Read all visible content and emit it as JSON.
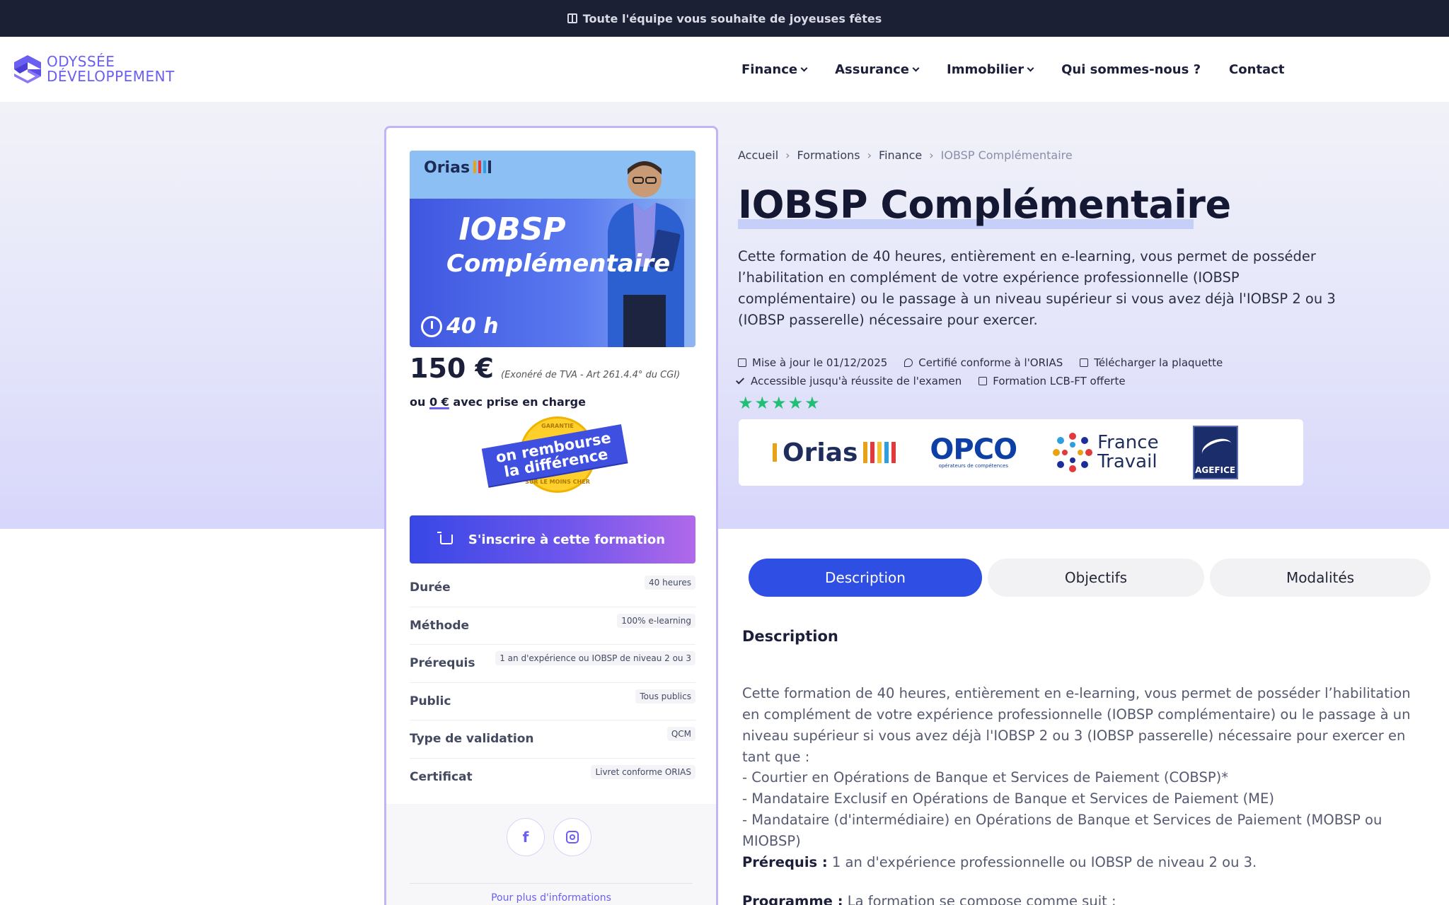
{
  "topbar": {
    "message": "Toute l'équipe vous souhaite de joyeuses fêtes"
  },
  "brand": {
    "line1": "ODYSSÉE",
    "line2": "DÉVELOPPEMENT",
    "accent": "#6a5ff0"
  },
  "nav": {
    "items": [
      {
        "label": "Finance",
        "dropdown": true
      },
      {
        "label": "Assurance",
        "dropdown": true
      },
      {
        "label": "Immobilier",
        "dropdown": true
      },
      {
        "label": "Qui sommes-nous ?",
        "dropdown": false
      },
      {
        "label": "Contact",
        "dropdown": false
      }
    ]
  },
  "product_image": {
    "orias": "Orias",
    "title_line1": "IOBSP",
    "title_line2": "Complémentaire",
    "duration": "40 h"
  },
  "pricing": {
    "price": "150 €",
    "tax_note": "(Exonéré de TVA - Art 261.4.4° du CGI)",
    "alt_prefix": "ou",
    "alt_amount": "0 €",
    "alt_suffix": "avec prise en charge"
  },
  "guarantee_badge": {
    "top_text": "GARANTIE",
    "band_line1": "on rembourse",
    "band_line2": "la différence",
    "bottom_text": "SUR LE MOINS CHER"
  },
  "cta": {
    "label": "S'inscrire à cette formation"
  },
  "specs": [
    {
      "label": "Durée",
      "value": "40 heures"
    },
    {
      "label": "Méthode",
      "value": "100% e-learning"
    },
    {
      "label": "Prérequis",
      "value": "1 an d'expérience ou IOBSP de niveau 2 ou 3"
    },
    {
      "label": "Public",
      "value": "Tous publics"
    },
    {
      "label": "Type de validation",
      "value": "QCM"
    },
    {
      "label": "Certificat",
      "value": "Livret conforme ORIAS"
    }
  ],
  "card_footer": {
    "facebook": "f",
    "more_info": "Pour plus d'informations"
  },
  "breadcrumb": [
    "Accueil",
    "Formations",
    "Finance",
    "IOBSP Complémentaire"
  ],
  "page": {
    "title": "IOBSP Complémentaire",
    "intro": "Cette formation de 40 heures, entièrement en e-learning, vous permet de posséder l’habilitation en complément de votre expérience professionnelle (IOBSP complémentaire) ou le passage à un niveau supérieur si vous avez déjà l'IOBSP 2 ou 3 (IOBSP passerelle) nécessaire pour exercer."
  },
  "meta": {
    "updated": "Mise à jour le 01/12/2025",
    "certified": "Certifié conforme à l'ORIAS",
    "download": "Télécharger la plaquette",
    "access": "Accessible jusqu'à réussite de l'examen",
    "gift": "Formation LCB-FT offerte",
    "stars": "★★★★★",
    "rating": 5
  },
  "partners": {
    "orias": "Orias",
    "opco": "OPCO",
    "opco_sub": "opérateurs de compétences",
    "ft_line1": "France",
    "ft_line2": "Travail",
    "agefice": "AGEFICE"
  },
  "tabs": [
    {
      "label": "Description",
      "active": true
    },
    {
      "label": "Objectifs",
      "active": false
    },
    {
      "label": "Modalités",
      "active": false
    }
  ],
  "description": {
    "heading": "Description",
    "body": "Cette formation de 40 heures, entièrement en e-learning, vous permet de posséder l’habilitation en complément de votre expérience professionnelle (IOBSP complémentaire) ou le passage à un niveau supérieur si vous avez déjà l'IOBSP 2 ou 3 (IOBSP passerelle) nécessaire pour exercer en tant que :",
    "list": [
      "- Courtier en Opérations de Banque et Services de Paiement (COBSP)*",
      "- Mandataire Exclusif en Opérations de Banque et Services de Paiement (ME)",
      "- Mandataire (d'intermédiaire) en Opérations de Banque et Services de Paiement (MOBSP ou MIOBSP)"
    ],
    "prereq_label": "Prérequis :",
    "prereq_text": " 1 an d'expérience professionnelle ou IOBSP de niveau 2 ou 3.",
    "programme_label": "Programme :",
    "programme_text": " La formation se compose comme suit :"
  },
  "colors": {
    "topbar": "#1c2035",
    "primary": "#2f4ee3",
    "stars": "#1fbf74",
    "card_border": "#c3b4f5"
  }
}
